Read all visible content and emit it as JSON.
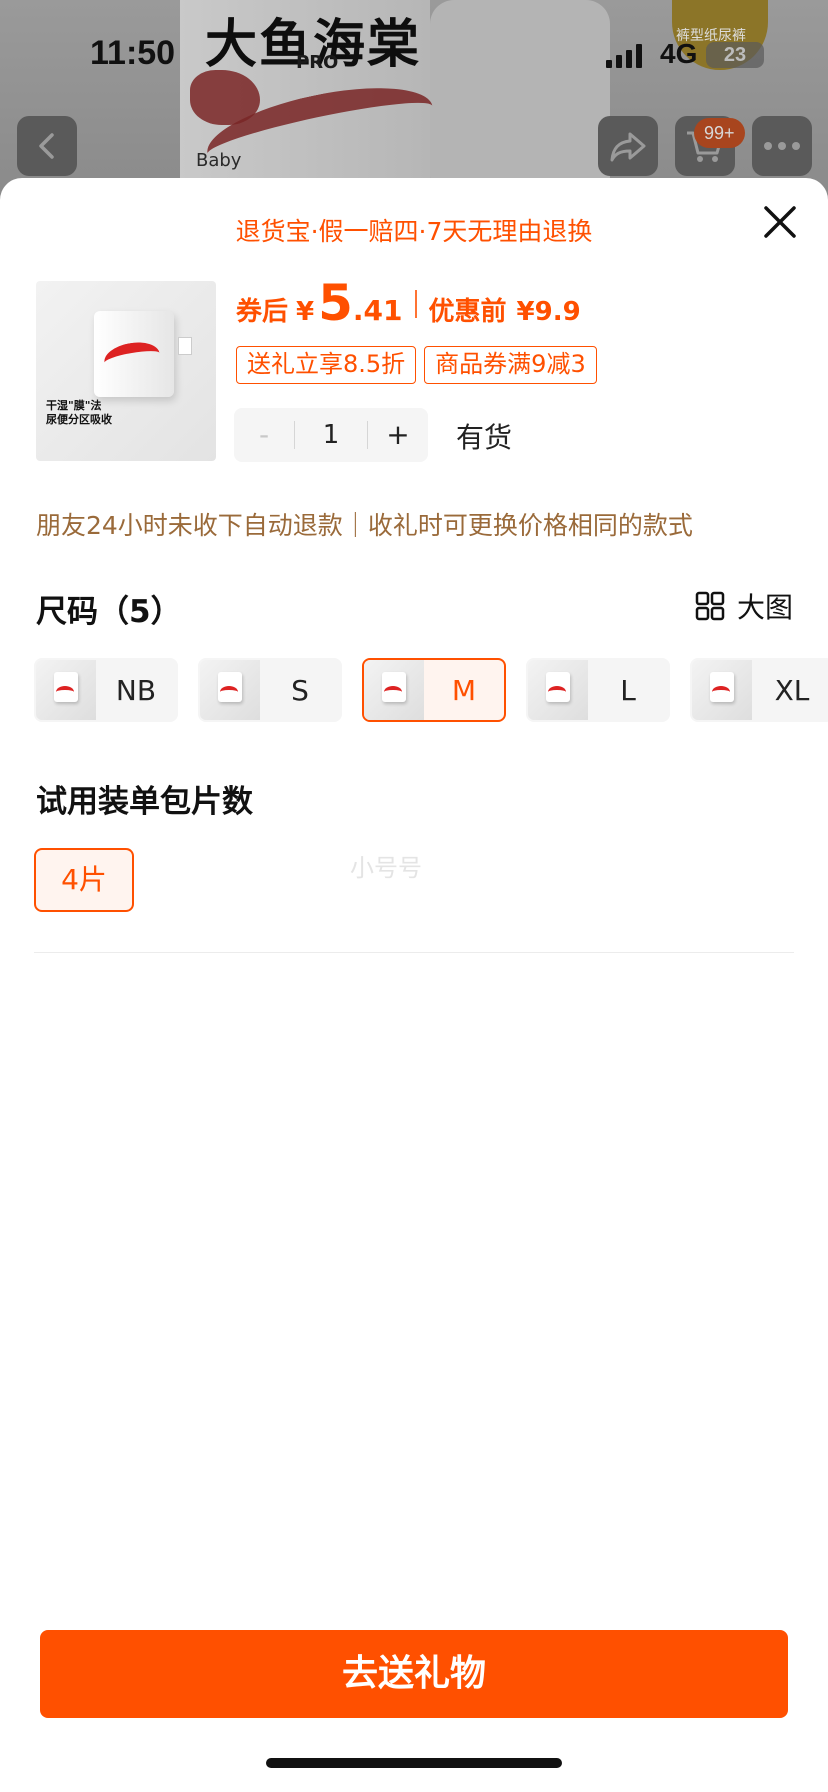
{
  "status_bar": {
    "time": "11:50",
    "network": "4G",
    "battery": "23"
  },
  "background": {
    "brand_text": "大鱼海棠",
    "sub_text": "PRO",
    "baby_text": "Baby",
    "tag_text": "裤型纸尿裤",
    "cart_badge": "99+"
  },
  "sheet": {
    "guarantee_text": "退货宝·假一赔四·7天无理由退换",
    "product_caption_line1": "干湿\"膜\"法",
    "product_caption_line2": "尿便分区吸收",
    "price": {
      "prefix": "券后",
      "currency": "¥",
      "integer": "5",
      "decimal": ".41",
      "before_label": "优惠前",
      "before_value": "¥9.9"
    },
    "promo_tags": [
      "送礼立享8.5折",
      "商品券满9减3"
    ],
    "quantity": {
      "minus": "-",
      "value": "1",
      "plus": "+"
    },
    "stock_status": "有货",
    "gift_note": "朋友24小时未收下自动退款｜收礼时可更换价格相同的款式",
    "size_section": {
      "title": "尺码（5）",
      "big_view_label": "大图",
      "options": [
        "NB",
        "S",
        "M",
        "L",
        "XL"
      ],
      "selected": "M"
    },
    "pack_section": {
      "title": "试用装单包片数",
      "options": [
        "4片"
      ],
      "selected": "4片"
    },
    "watermark": "小号号",
    "cta_label": "去送礼物"
  },
  "colors": {
    "accent": "#ff5000",
    "note": "#9a6a3a"
  },
  "icons": [
    "back-icon",
    "share-icon",
    "cart-icon",
    "more-icon",
    "close-icon",
    "grid-view-icon"
  ]
}
